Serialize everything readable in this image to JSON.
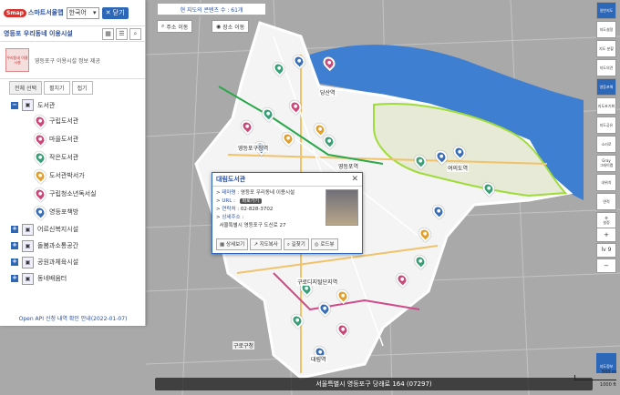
{
  "app": {
    "logo_badge": "Smap",
    "logo_text": "스마트서울맵",
    "language": "한국어",
    "close_label": "닫기"
  },
  "panel": {
    "title": "영등포 우리동네 이용시설",
    "thumb_text": "우리동네 이용시설",
    "description": "영등포구 이용시설 정보 제공",
    "tabs": [
      "전체 선택",
      "펼치기",
      "접기"
    ],
    "categories": [
      {
        "label": "도서관",
        "expander": "−",
        "children": [
          "구립도서관",
          "마을도서관",
          "작은도서관",
          "도서관박서가",
          "구립청소년독서실",
          "영등포책방"
        ]
      },
      {
        "label": "어르신복지시설",
        "expander": "+"
      },
      {
        "label": "돌봄과소통공간",
        "expander": "+"
      },
      {
        "label": "공원과체육시설",
        "expander": "+"
      },
      {
        "label": "동네배움터",
        "expander": "+"
      }
    ],
    "footer_link": "Open API 신청 내역 확인 안내(2022-01-07)"
  },
  "map": {
    "notice": "현 지도의 콘텐츠 수 : 61개",
    "move_buttons": [
      "주소 이동",
      "장소 이동"
    ],
    "labels": [
      "당산역",
      "영등포구청역",
      "영등포역",
      "대림역",
      "구로디지털단지역",
      "신림역",
      "구로구청",
      "여의도역"
    ],
    "address_bar": "서울특별시 영등포구 당래로 164 (07297)",
    "scale": [
      "500 m",
      "1000 ft"
    ],
    "map_info": "지도정보"
  },
  "popup": {
    "title": "대림도서관",
    "rows": [
      {
        "key": "테마명",
        "value": "영등포 우리동네 이용시설"
      },
      {
        "key": "URL",
        "value": "",
        "link": "바로가기"
      },
      {
        "key": "연락처",
        "value": "02-828-3702"
      },
      {
        "key": "상세주소",
        "value": ""
      },
      {
        "key": "",
        "value": "서울특별시 영등포구 도신로 27"
      }
    ],
    "buttons": [
      "상세보기",
      "지도복사",
      "길찾기",
      "로드뷰"
    ]
  },
  "tools": {
    "items": [
      "일반지도",
      "지도설정",
      "지도 분할",
      "지도의견",
      "영등포해",
      "지도초기화",
      "지도공유",
      "소리로",
      "Gray",
      "그레이맵",
      "내위치",
      "면적",
      "설정"
    ],
    "zoom": [
      "+",
      "lv 9",
      "−"
    ]
  },
  "colors": {
    "accent": "#2d67b7",
    "river": "#3f7fd1",
    "district": "#ffffff",
    "outline": "#9fdc3a"
  }
}
